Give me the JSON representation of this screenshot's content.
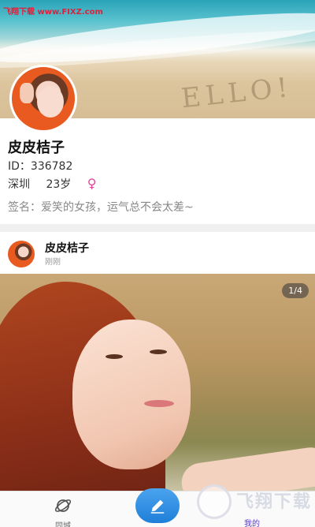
{
  "watermark": {
    "top_text": "飞翔下载 www.FIXZ.com",
    "brand_text": "飞翔下载"
  },
  "cover": {
    "sand_text": "ELLO!"
  },
  "profile": {
    "name": "皮皮桔子",
    "id_label": "ID：336782",
    "city": "深圳",
    "age": "23岁",
    "gender_symbol": "♀",
    "signature": "签名：爱笑的女孩，运气总不会太差~"
  },
  "post": {
    "author": "皮皮桔子",
    "time": "刚刚",
    "image_counter": "1/4"
  },
  "nav": {
    "city_label": "同城",
    "mine_label": "我的"
  },
  "colors": {
    "accent_purple": "#5a39c8",
    "post_button": "#2b8ce2",
    "gender_pink": "#e0459a"
  }
}
